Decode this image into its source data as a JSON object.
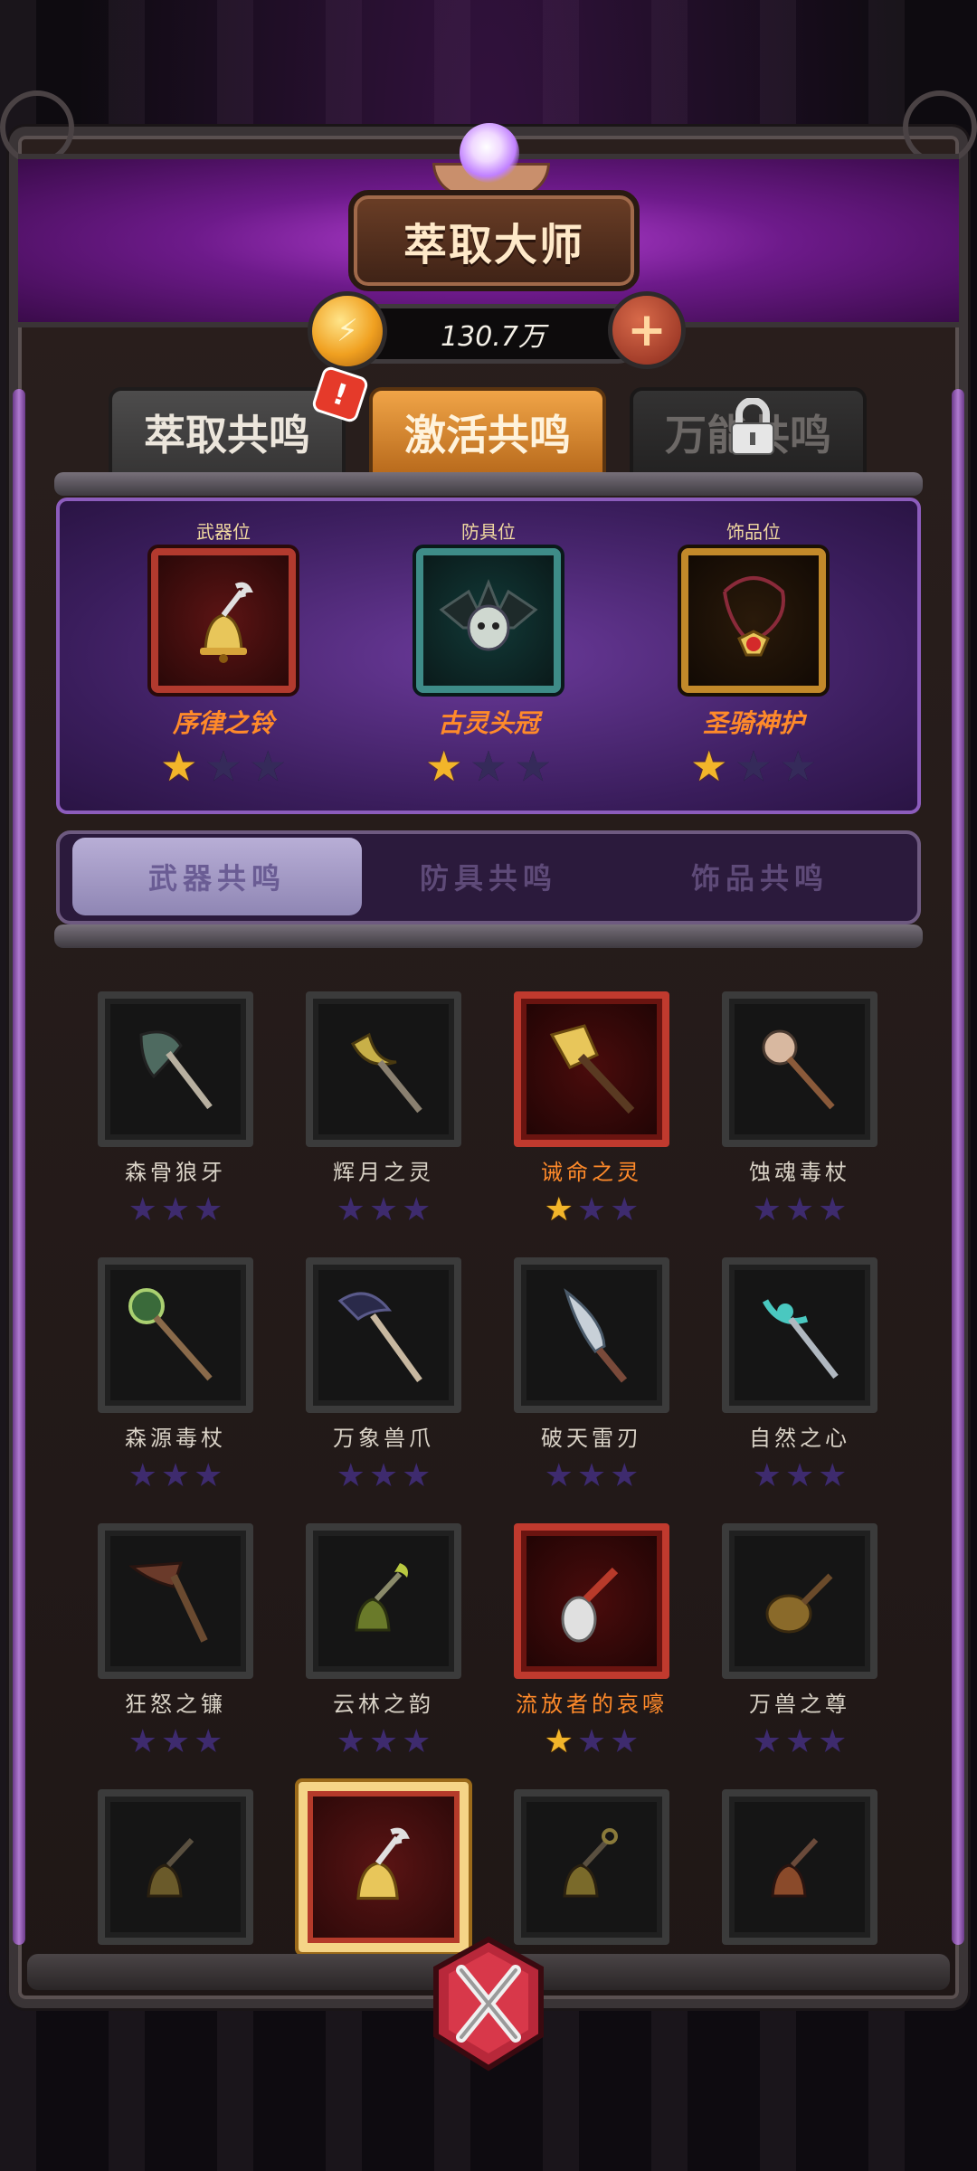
{
  "header": {
    "title": "萃取大师",
    "currency_value": "130.7万"
  },
  "top_tabs": [
    {
      "label": "萃取共鸣",
      "state": "inactive",
      "alert": true
    },
    {
      "label": "激活共鸣",
      "state": "active"
    },
    {
      "label": "万能共鸣",
      "state": "locked"
    }
  ],
  "equipped_slots": [
    {
      "slot_label": "武器位",
      "name": "序律之铃",
      "stars": 1,
      "frame_color": "#b23a2e"
    },
    {
      "slot_label": "防具位",
      "name": "古灵头冠",
      "stars": 1,
      "frame_color": "#3e8c88"
    },
    {
      "slot_label": "饰品位",
      "name": "圣骑神护",
      "stars": 1,
      "frame_color": "#c2892a"
    }
  ],
  "sub_tabs": [
    {
      "label": "武器共鸣",
      "active": true
    },
    {
      "label": "防具共鸣",
      "active": false
    },
    {
      "label": "饰品共鸣",
      "active": false
    }
  ],
  "weapons": [
    {
      "name": "森骨狼牙",
      "stars": 0,
      "highlight": false,
      "icon": "bone-axe-icon"
    },
    {
      "name": "辉月之灵",
      "stars": 0,
      "highlight": false,
      "icon": "moon-staff-icon"
    },
    {
      "name": "诫命之灵",
      "stars": 1,
      "highlight": true,
      "icon": "golden-mace-icon"
    },
    {
      "name": "蚀魂毒杖",
      "stars": 0,
      "highlight": false,
      "icon": "skull-staff-icon"
    },
    {
      "name": "森源毒杖",
      "stars": 0,
      "highlight": false,
      "icon": "orb-staff-icon"
    },
    {
      "name": "万象兽爪",
      "stars": 0,
      "highlight": false,
      "icon": "claw-staff-icon"
    },
    {
      "name": "破天雷刃",
      "stars": 0,
      "highlight": false,
      "icon": "curved-blade-icon"
    },
    {
      "name": "自然之心",
      "stars": 0,
      "highlight": false,
      "icon": "crescent-staff-icon"
    },
    {
      "name": "狂怒之镰",
      "stars": 0,
      "highlight": false,
      "icon": "scythe-icon"
    },
    {
      "name": "云林之韵",
      "stars": 0,
      "highlight": false,
      "icon": "green-bell-icon"
    },
    {
      "name": "流放者的哀嚎",
      "stars": 1,
      "highlight": true,
      "icon": "bone-club-icon"
    },
    {
      "name": "万兽之尊",
      "stars": 0,
      "highlight": false,
      "icon": "gourd-icon"
    },
    {
      "name": "",
      "stars": 0,
      "highlight": false,
      "icon": "bronze-bell-icon"
    },
    {
      "name": "",
      "stars": 0,
      "highlight": "selected",
      "icon": "gold-bell-icon"
    },
    {
      "name": "",
      "stars": 0,
      "highlight": false,
      "icon": "dark-bell-icon"
    },
    {
      "name": "",
      "stars": 0,
      "highlight": false,
      "icon": "copper-bell-icon"
    }
  ],
  "colors": {
    "accent_orange": "#f0a447",
    "star_on": "#f2b52a",
    "star_off": "#3e2b6e",
    "highlight_name": "#ff8a2a"
  }
}
